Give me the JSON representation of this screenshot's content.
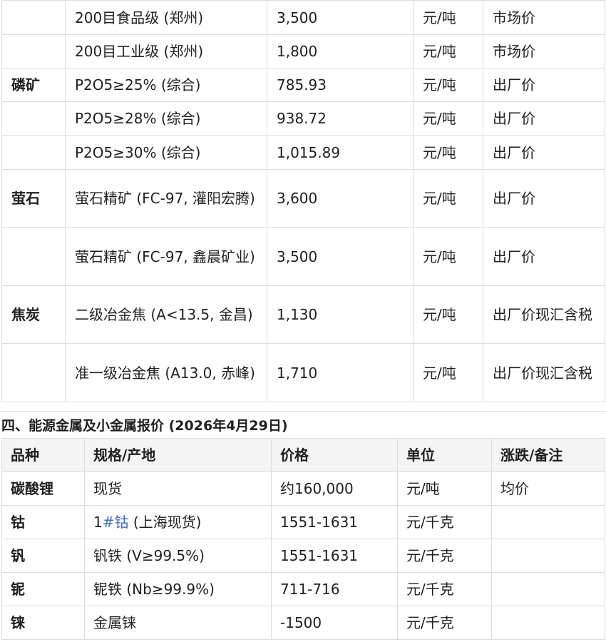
{
  "table1": {
    "rows": [
      {
        "category": "",
        "spec": "200目食品级 (郑州)",
        "price": "3,500",
        "unit": "元/吨",
        "note": "市场价"
      },
      {
        "category": "",
        "spec": "200目工业级 (郑州)",
        "price": "1,800",
        "unit": "元/吨",
        "note": "市场价"
      },
      {
        "category": "磷矿",
        "spec": "P2O5≥25% (综合)",
        "price": "785.93",
        "unit": "元/吨",
        "note": "出厂价"
      },
      {
        "category": "",
        "spec": "P2O5≥28% (综合)",
        "price": "938.72",
        "unit": "元/吨",
        "note": "出厂价"
      },
      {
        "category": "",
        "spec": "P2O5≥30% (综合)",
        "price": "1,015.89",
        "unit": "元/吨",
        "note": "出厂价"
      },
      {
        "category": "萤石",
        "spec": "萤石精矿 (FC-97, 灌阳宏腾)",
        "price": "3,600",
        "unit": "元/吨",
        "note": "出厂价"
      },
      {
        "category": "",
        "spec": "萤石精矿 (FC-97, 鑫晨矿业)",
        "price": "3,500",
        "unit": "元/吨",
        "note": "出厂价"
      },
      {
        "category": "焦炭",
        "spec": "二级冶金焦 (A<13.5, 金昌)",
        "price": "1,130",
        "unit": "元/吨",
        "note": "出厂价现汇含税"
      },
      {
        "category": "",
        "spec": "准一级冶金焦 (A13.0, 赤峰)",
        "price": "1,710",
        "unit": "元/吨",
        "note": "出厂价现汇含税"
      }
    ]
  },
  "section4": {
    "title": "四、能源金属及小金属报价 (2026年4月29日)",
    "headers": [
      "品种",
      "规格/产地",
      "价格",
      "单位",
      "涨跌/备注"
    ],
    "rows": [
      {
        "category": "碳酸锂",
        "spec": "现货",
        "price": "约160,000",
        "unit": "元/吨",
        "note": "均价"
      },
      {
        "category": "钴",
        "spec_prefix": "1",
        "spec_hash": "#钴",
        "spec_suffix": " (上海现货)",
        "price": "1551-1631",
        "unit": "元/千克",
        "note": ""
      },
      {
        "category": "钒",
        "spec": "钒铁 (V≥99.5%)",
        "price": "1551-1631",
        "unit": "元/千克",
        "note": ""
      },
      {
        "category": "铌",
        "spec": "铌铁 (Nb≥99.9%)",
        "price": "711-716",
        "unit": "元/千克",
        "note": ""
      },
      {
        "category": "铼",
        "spec": "金属铼",
        "price": "-1500",
        "unit": "元/千克",
        "note": ""
      }
    ]
  }
}
